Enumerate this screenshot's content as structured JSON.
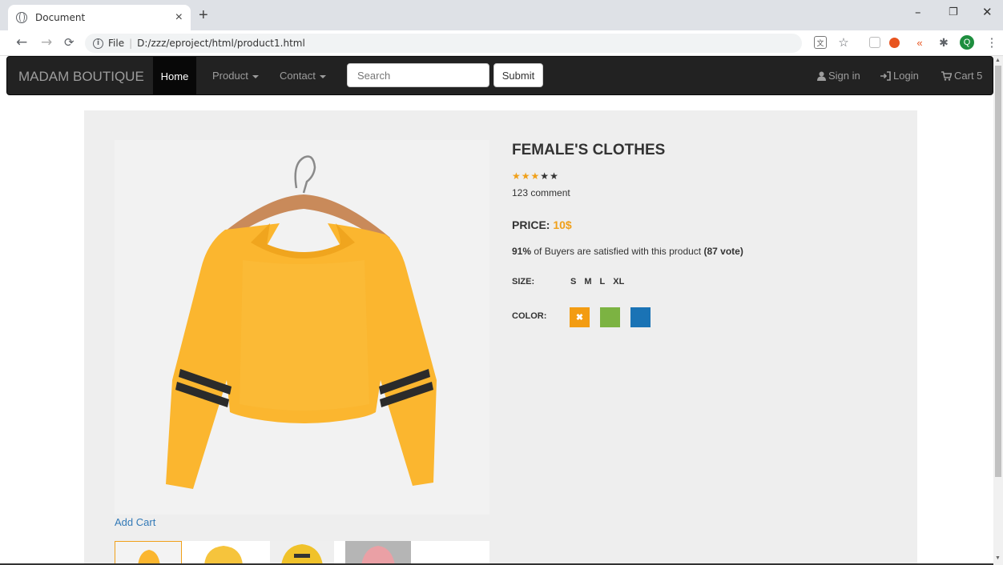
{
  "browser": {
    "tab_title": "Document",
    "tab_close": "×",
    "new_tab": "+",
    "url_prefix": "File",
    "url": "D:/zzz/eproject/html/product1.html",
    "minimize": "–",
    "restore": "❐",
    "close": "✕",
    "profile_initial": "Q"
  },
  "navbar": {
    "brand": "MADAM BOUTIQUE",
    "home": "Home",
    "product": "Product",
    "contact": "Contact",
    "search_placeholder": "Search",
    "submit": "Submit",
    "sign_in": "Sign in",
    "login": "Login",
    "cart": "Cart 5"
  },
  "product": {
    "title": "FEMALE'S CLOTHES",
    "rating": 3,
    "rating_max": 5,
    "comments": "123 comment",
    "price_label": "PRICE:",
    "price_value": "10$",
    "satisfaction_pct": "91%",
    "satisfaction_text": " of Buyers are satisfied with this product ",
    "votes": "(87 vote)",
    "size_label": "SIZE:",
    "sizes": [
      "S",
      "M",
      "L",
      "XL"
    ],
    "color_label": "COLOR:",
    "colors": [
      "#f39c12",
      "#7cb342",
      "#1a73b5"
    ],
    "selected_color_mark": "✖",
    "add_cart": "Add Cart"
  },
  "colors": {
    "accent": "#f0a01a",
    "link": "#337ab7",
    "navbar_bg": "#222222"
  }
}
